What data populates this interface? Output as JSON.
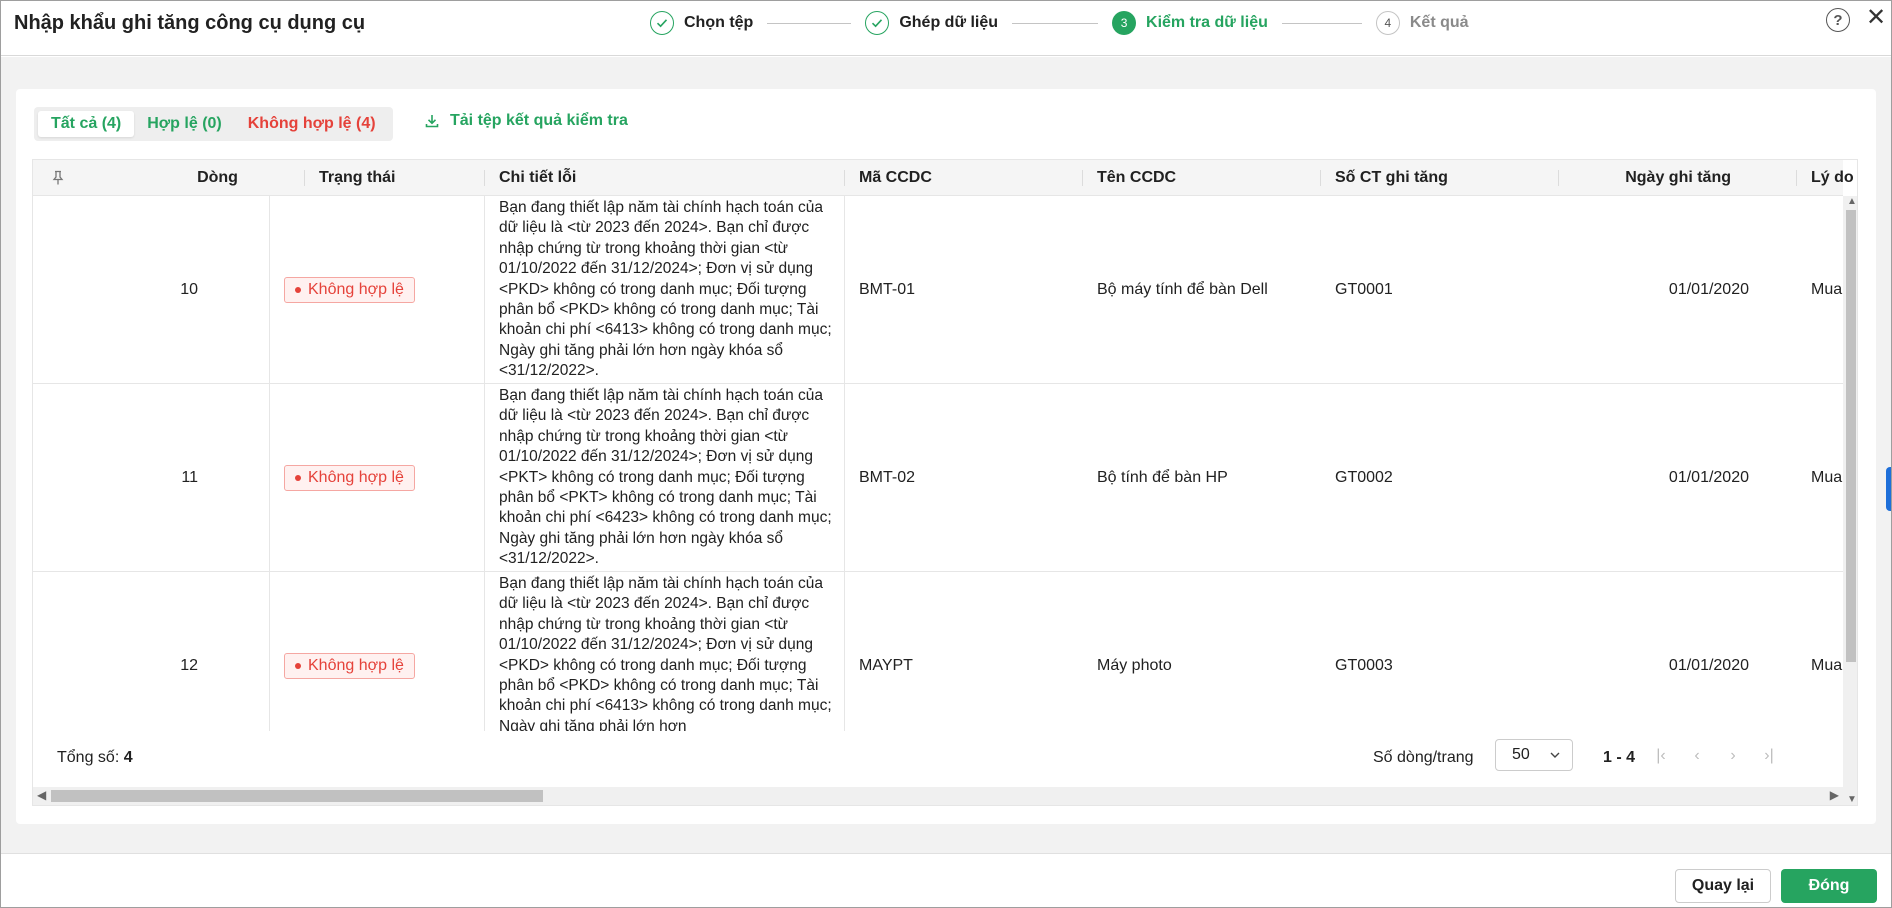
{
  "header": {
    "title": "Nhập khẩu ghi tăng công cụ dụng cụ",
    "steps": [
      {
        "label": "Chọn tệp",
        "state": "done"
      },
      {
        "label": "Ghép dữ liệu",
        "state": "done"
      },
      {
        "number": "3",
        "label": "Kiểm tra dữ liệu",
        "state": "active"
      },
      {
        "number": "4",
        "label": "Kết quả",
        "state": "todo"
      }
    ],
    "help_icon": "question-circle-icon",
    "close_icon": "close-icon"
  },
  "tabs": {
    "all": "Tất cả (4)",
    "valid": "Hợp lệ (0)",
    "invalid": "Không hợp lệ (4)"
  },
  "download_label": "Tải tệp kết quả kiểm tra",
  "table": {
    "columns": {
      "dong": "Dòng",
      "trang_thai": "Trạng thái",
      "chi_tiet": "Chi tiết lỗi",
      "ma": "Mã CCDC",
      "ten": "Tên CCDC",
      "so_ct": "Số CT ghi tăng",
      "ngay": "Ngày ghi tăng",
      "ly_do": "Lý do gh"
    },
    "rows": [
      {
        "dong": "10",
        "trang_thai": "Không hợp lệ",
        "chi_tiet": "Bạn đang thiết lập năm tài chính hạch toán của dữ liệu là <từ 2023 đến 2024>. Bạn chỉ được nhập chứng từ trong khoảng thời gian <từ 01/10/2022 đến 31/12/2024>; Đơn vị sử dụng <PKD> không có trong danh mục; Đối tượng phân bổ <PKD> không có trong danh mục; Tài khoản chi phí <6413> không có trong danh mục; Ngày ghi tăng phải lớn hơn ngày khóa sổ <31/12/2022>.",
        "ma": "BMT-01",
        "ten": "Bộ máy tính để bàn Dell",
        "so_ct": "GT0001",
        "ngay": "01/01/2020",
        "ly_do": "Mua mới"
      },
      {
        "dong": "11",
        "trang_thai": "Không hợp lệ",
        "chi_tiet": "Bạn đang thiết lập năm tài chính hạch toán của dữ liệu là <từ 2023 đến 2024>. Bạn chỉ được nhập chứng từ trong khoảng thời gian <từ 01/10/2022 đến 31/12/2024>; Đơn vị sử dụng <PKT> không có trong danh mục; Đối tượng phân bổ <PKT> không có trong danh mục; Tài khoản chi phí <6423> không có trong danh mục; Ngày ghi tăng phải lớn hơn ngày khóa sổ <31/12/2022>.",
        "ma": "BMT-02",
        "ten": "Bộ tính để bàn HP",
        "so_ct": "GT0002",
        "ngay": "01/01/2020",
        "ly_do": "Mua mới"
      },
      {
        "dong": "12",
        "trang_thai": "Không hợp lệ",
        "chi_tiet": "Bạn đang thiết lập năm tài chính hạch toán của dữ liệu là <từ 2023 đến 2024>. Bạn chỉ được nhập chứng từ trong khoảng thời gian <từ 01/10/2022 đến 31/12/2024>; Đơn vị sử dụng <PKD> không có trong danh mục; Đối tượng phân bổ <PKD> không có trong danh mục; Tài khoản chi phí <6413> không có trong danh mục; Ngày ghi tăng phải lớn hơn",
        "ma": "MAYPT",
        "ten": "Máy photo",
        "so_ct": "GT0003",
        "ngay": "01/01/2020",
        "ly_do": "Mua mới"
      }
    ]
  },
  "footer": {
    "total_label": "Tổng số:",
    "total_value": "4",
    "per_page_label": "Số dòng/trang",
    "per_page_value": "50",
    "range": "1 - 4"
  },
  "buttons": {
    "back": "Quay lại",
    "close": "Đóng"
  },
  "colors": {
    "accent": "#26a460",
    "error": "#e5423a"
  }
}
